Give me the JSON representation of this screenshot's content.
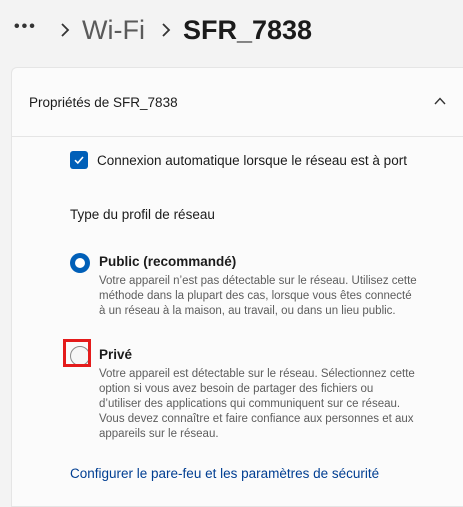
{
  "breadcrumb": {
    "more": "•••",
    "parent": "Wi-Fi",
    "current": "SFR_7838"
  },
  "card": {
    "title": "Propriétés de SFR_7838",
    "auto_connect": {
      "label": "Connexion automatique lorsque le réseau est à port",
      "checked": true
    },
    "profile_label": "Type du profil de réseau",
    "options": [
      {
        "title": "Public (recommandé)",
        "description": "Votre appareil n’est pas détectable sur le réseau. Utilisez cette méthode dans la plupart des cas, lorsque vous êtes connecté à un réseau à la maison, au travail, ou dans un lieu public.",
        "selected": true
      },
      {
        "title": "Privé",
        "description": "Votre appareil est détectable sur le réseau. Sélectionnez cette option si vous avez besoin de partager des fichiers ou d’utiliser des applications qui communiquent sur ce réseau. Vous devez connaître et faire confiance aux personnes et aux appareils sur le réseau.",
        "selected": false
      }
    ],
    "firewall_link": "Configurer le pare-feu et les paramètres de sécurité"
  },
  "colors": {
    "accent": "#005fb8",
    "link": "#003e92",
    "highlight": "#e41b1b"
  }
}
